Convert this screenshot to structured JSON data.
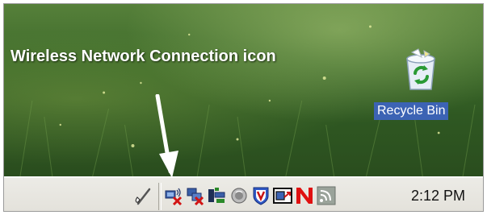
{
  "annotation": {
    "text": "Wireless Network Connection icon"
  },
  "desktop": {
    "recycle_bin": {
      "label": "Recycle Bin",
      "icon": "recycle-bin-icon"
    }
  },
  "taskbar": {
    "tray_icons": [
      "pen-tablet-icon",
      "wireless-network-disconnected-icon",
      "lan-disconnected-icon",
      "network-adapter-icon",
      "sound-icon",
      "mcafee-shield-icon",
      "display-settings-icon",
      "norton-icon",
      "feed-icon"
    ],
    "clock": "2:12 PM"
  },
  "colors": {
    "selection_blue": "#3c63b4",
    "grass_green": "#3d6a2a",
    "taskbar_beige": "#ecebe6",
    "error_red": "#d21414",
    "norton_red": "#e01010"
  }
}
